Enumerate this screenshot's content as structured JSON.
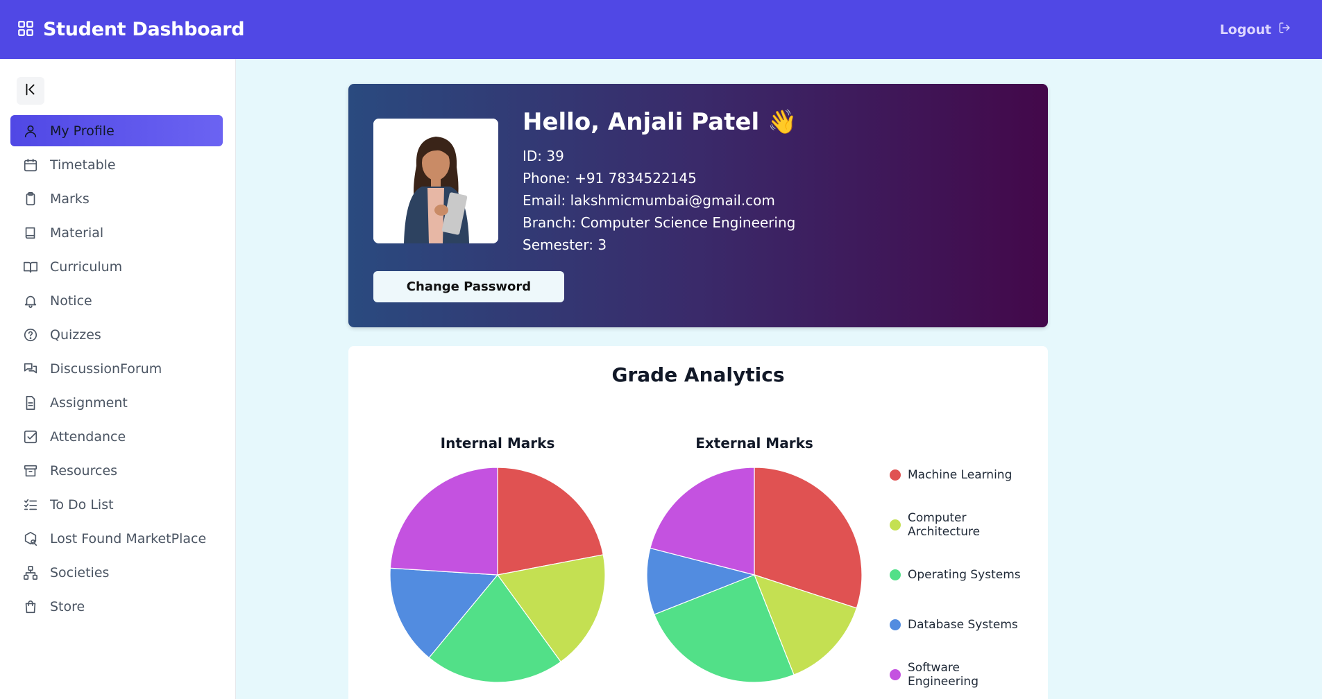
{
  "header": {
    "title": "Student Dashboard",
    "logout_label": "Logout"
  },
  "sidebar": {
    "items": [
      {
        "label": "My Profile",
        "icon": "user-icon",
        "active": true
      },
      {
        "label": "Timetable",
        "icon": "calendar-icon"
      },
      {
        "label": "Marks",
        "icon": "clipboard-icon"
      },
      {
        "label": "Material",
        "icon": "book-icon"
      },
      {
        "label": "Curriculum",
        "icon": "book-open-icon"
      },
      {
        "label": "Notice",
        "icon": "bell-icon"
      },
      {
        "label": "Quizzes",
        "icon": "help-circle-icon"
      },
      {
        "label": "DiscussionForum",
        "icon": "chat-icon"
      },
      {
        "label": "Assignment",
        "icon": "file-text-icon"
      },
      {
        "label": "Attendance",
        "icon": "check-square-icon"
      },
      {
        "label": "Resources",
        "icon": "archive-icon"
      },
      {
        "label": "To Do List",
        "icon": "list-check-icon"
      },
      {
        "label": "Lost Found MarketPlace",
        "icon": "package-search-icon"
      },
      {
        "label": "Societies",
        "icon": "network-icon"
      },
      {
        "label": "Store",
        "icon": "shopping-bag-icon"
      }
    ]
  },
  "profile": {
    "greeting": "Hello, Anjali Patel 👋",
    "id_label": "ID:",
    "id_value": "39",
    "phone_label": "Phone:",
    "phone_value": "+91 7834522145",
    "email_label": "Email:",
    "email_value": "lakshmicmumbai@gmail.com",
    "branch_label": "Branch:",
    "branch_value": "Computer Science Engineering",
    "semester_label": "Semester:",
    "semester_value": "3",
    "change_password_label": "Change Password"
  },
  "analytics": {
    "title": "Grade Analytics"
  },
  "colors": {
    "accent": "#5048e5"
  },
  "chart_data": {
    "type": "pie",
    "categories": [
      "Machine Learning",
      "Computer Architecture",
      "Operating Systems",
      "Database Systems",
      "Software Engineering"
    ],
    "colors": [
      "#e05252",
      "#c4e052",
      "#52e088",
      "#528ce0",
      "#c452e0"
    ],
    "series": [
      {
        "name": "Internal Marks",
        "values": [
          22,
          18,
          21,
          15,
          24
        ]
      },
      {
        "name": "External Marks",
        "values": [
          30,
          14,
          25,
          10,
          21
        ]
      }
    ],
    "legend": "right"
  }
}
